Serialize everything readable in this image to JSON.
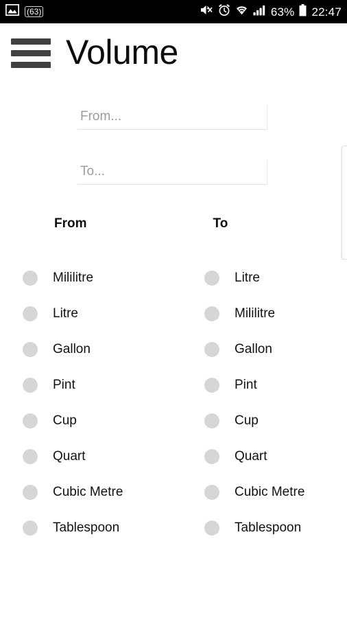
{
  "statusbar": {
    "left_icons": [
      {
        "name": "image-icon",
        "glyph": "image"
      },
      {
        "name": "count-badge",
        "label": "(63)"
      }
    ],
    "right_icons": [
      {
        "name": "mute-vibrate-icon"
      },
      {
        "name": "alarm-clock-icon"
      },
      {
        "name": "wifi-icon"
      },
      {
        "name": "cellular-signal-icon"
      },
      {
        "name": "battery-icon"
      }
    ],
    "battery_percent": "63%",
    "clock": "22:47"
  },
  "appbar": {
    "menu_icon": "hamburger-menu-icon",
    "title": "Volume"
  },
  "form": {
    "from_input": {
      "value": "",
      "placeholder": "From..."
    },
    "to_input": {
      "value": "",
      "placeholder": "To..."
    }
  },
  "columns": {
    "from_header": "From",
    "to_header": "To"
  },
  "from_units": [
    {
      "label": "Mililitre",
      "selected": false
    },
    {
      "label": "Litre",
      "selected": false
    },
    {
      "label": "Gallon",
      "selected": false
    },
    {
      "label": "Pint",
      "selected": false
    },
    {
      "label": "Cup",
      "selected": false
    },
    {
      "label": "Quart",
      "selected": false
    },
    {
      "label": "Cubic Metre",
      "selected": false
    },
    {
      "label": "Tablespoon",
      "selected": false
    }
  ],
  "to_units": [
    {
      "label": "Litre",
      "selected": false
    },
    {
      "label": "Mililitre",
      "selected": false
    },
    {
      "label": "Gallon",
      "selected": false
    },
    {
      "label": "Pint",
      "selected": false
    },
    {
      "label": "Cup",
      "selected": false
    },
    {
      "label": "Quart",
      "selected": false
    },
    {
      "label": "Cubic Metre",
      "selected": false
    },
    {
      "label": "Tablespoon",
      "selected": false
    }
  ],
  "colors": {
    "statusbar_bg": "#000000",
    "page_bg": "#ffffff",
    "radio_unselected": "#d6d6d6",
    "hamburger": "#414141",
    "text": "#111111",
    "placeholder": "#9b9b9b"
  }
}
